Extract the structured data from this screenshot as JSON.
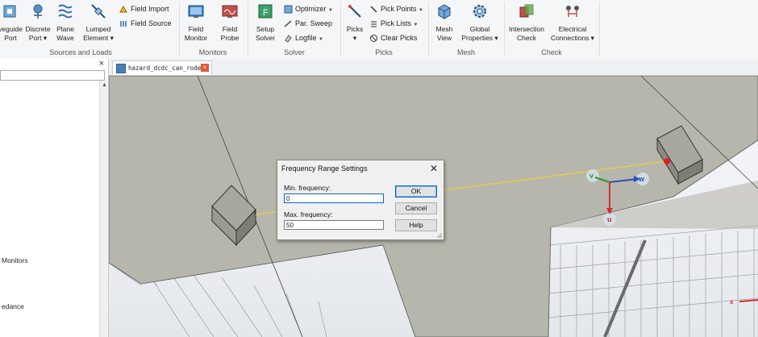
{
  "ribbon": {
    "buttons": [
      {
        "id": "waveguide-port",
        "line1": "veguide",
        "line2": "Port"
      },
      {
        "id": "discrete-port",
        "line1": "Discrete",
        "line2": "Port ▾"
      },
      {
        "id": "plane-wave",
        "line1": "Plane",
        "line2": "Wave"
      },
      {
        "id": "lumped-element",
        "line1": "Lumped",
        "line2": "Element ▾"
      },
      {
        "id": "field-monitor",
        "line1": "Field",
        "line2": "Monitor"
      },
      {
        "id": "field-probe",
        "line1": "Field",
        "line2": "Probe"
      },
      {
        "id": "setup-solver",
        "line1": "Setup",
        "line2": "Solver"
      },
      {
        "id": "picks",
        "line1": "Picks",
        "line2": "▾"
      },
      {
        "id": "mesh-view",
        "line1": "Mesh",
        "line2": "View"
      },
      {
        "id": "global-properties",
        "line1": "Global",
        "line2": "Properties ▾"
      },
      {
        "id": "intersection-check",
        "line1": "Intersection",
        "line2": "Check"
      },
      {
        "id": "electrical-connections",
        "line1": "Electrical",
        "line2": "Connections ▾"
      }
    ],
    "small": {
      "field_import": "Field Import",
      "field_source": "Field Source",
      "optimizer": "Optimizer",
      "par_sweep": "Par. Sweep",
      "logfile": "Logfile",
      "pick_points": "Pick Points",
      "pick_lists": "Pick Lists",
      "clear_picks": "Clear Picks"
    },
    "groups": {
      "sources_and_loads": "Sources and Loads",
      "monitors": "Monitors",
      "solver": "Solver",
      "picks": "Picks",
      "mesh": "Mesh",
      "check": "Check"
    }
  },
  "left_panel": {
    "close": "×",
    "items": [
      "Monitors",
      "edance"
    ]
  },
  "tab": {
    "label": "hazard_dcdc_can_rode",
    "close": "×"
  },
  "viewport": {
    "axes": {
      "v": "v",
      "w": "w",
      "u": "u",
      "x": "x"
    },
    "port_label": "1"
  },
  "dialog": {
    "title": "Frequency Range Settings",
    "close": "✕",
    "min_label": "Min. frequency:",
    "min_value": "0",
    "max_label": "Max. frequency:",
    "max_value": "50",
    "ok": "OK",
    "cancel": "Cancel",
    "help": "Help"
  }
}
